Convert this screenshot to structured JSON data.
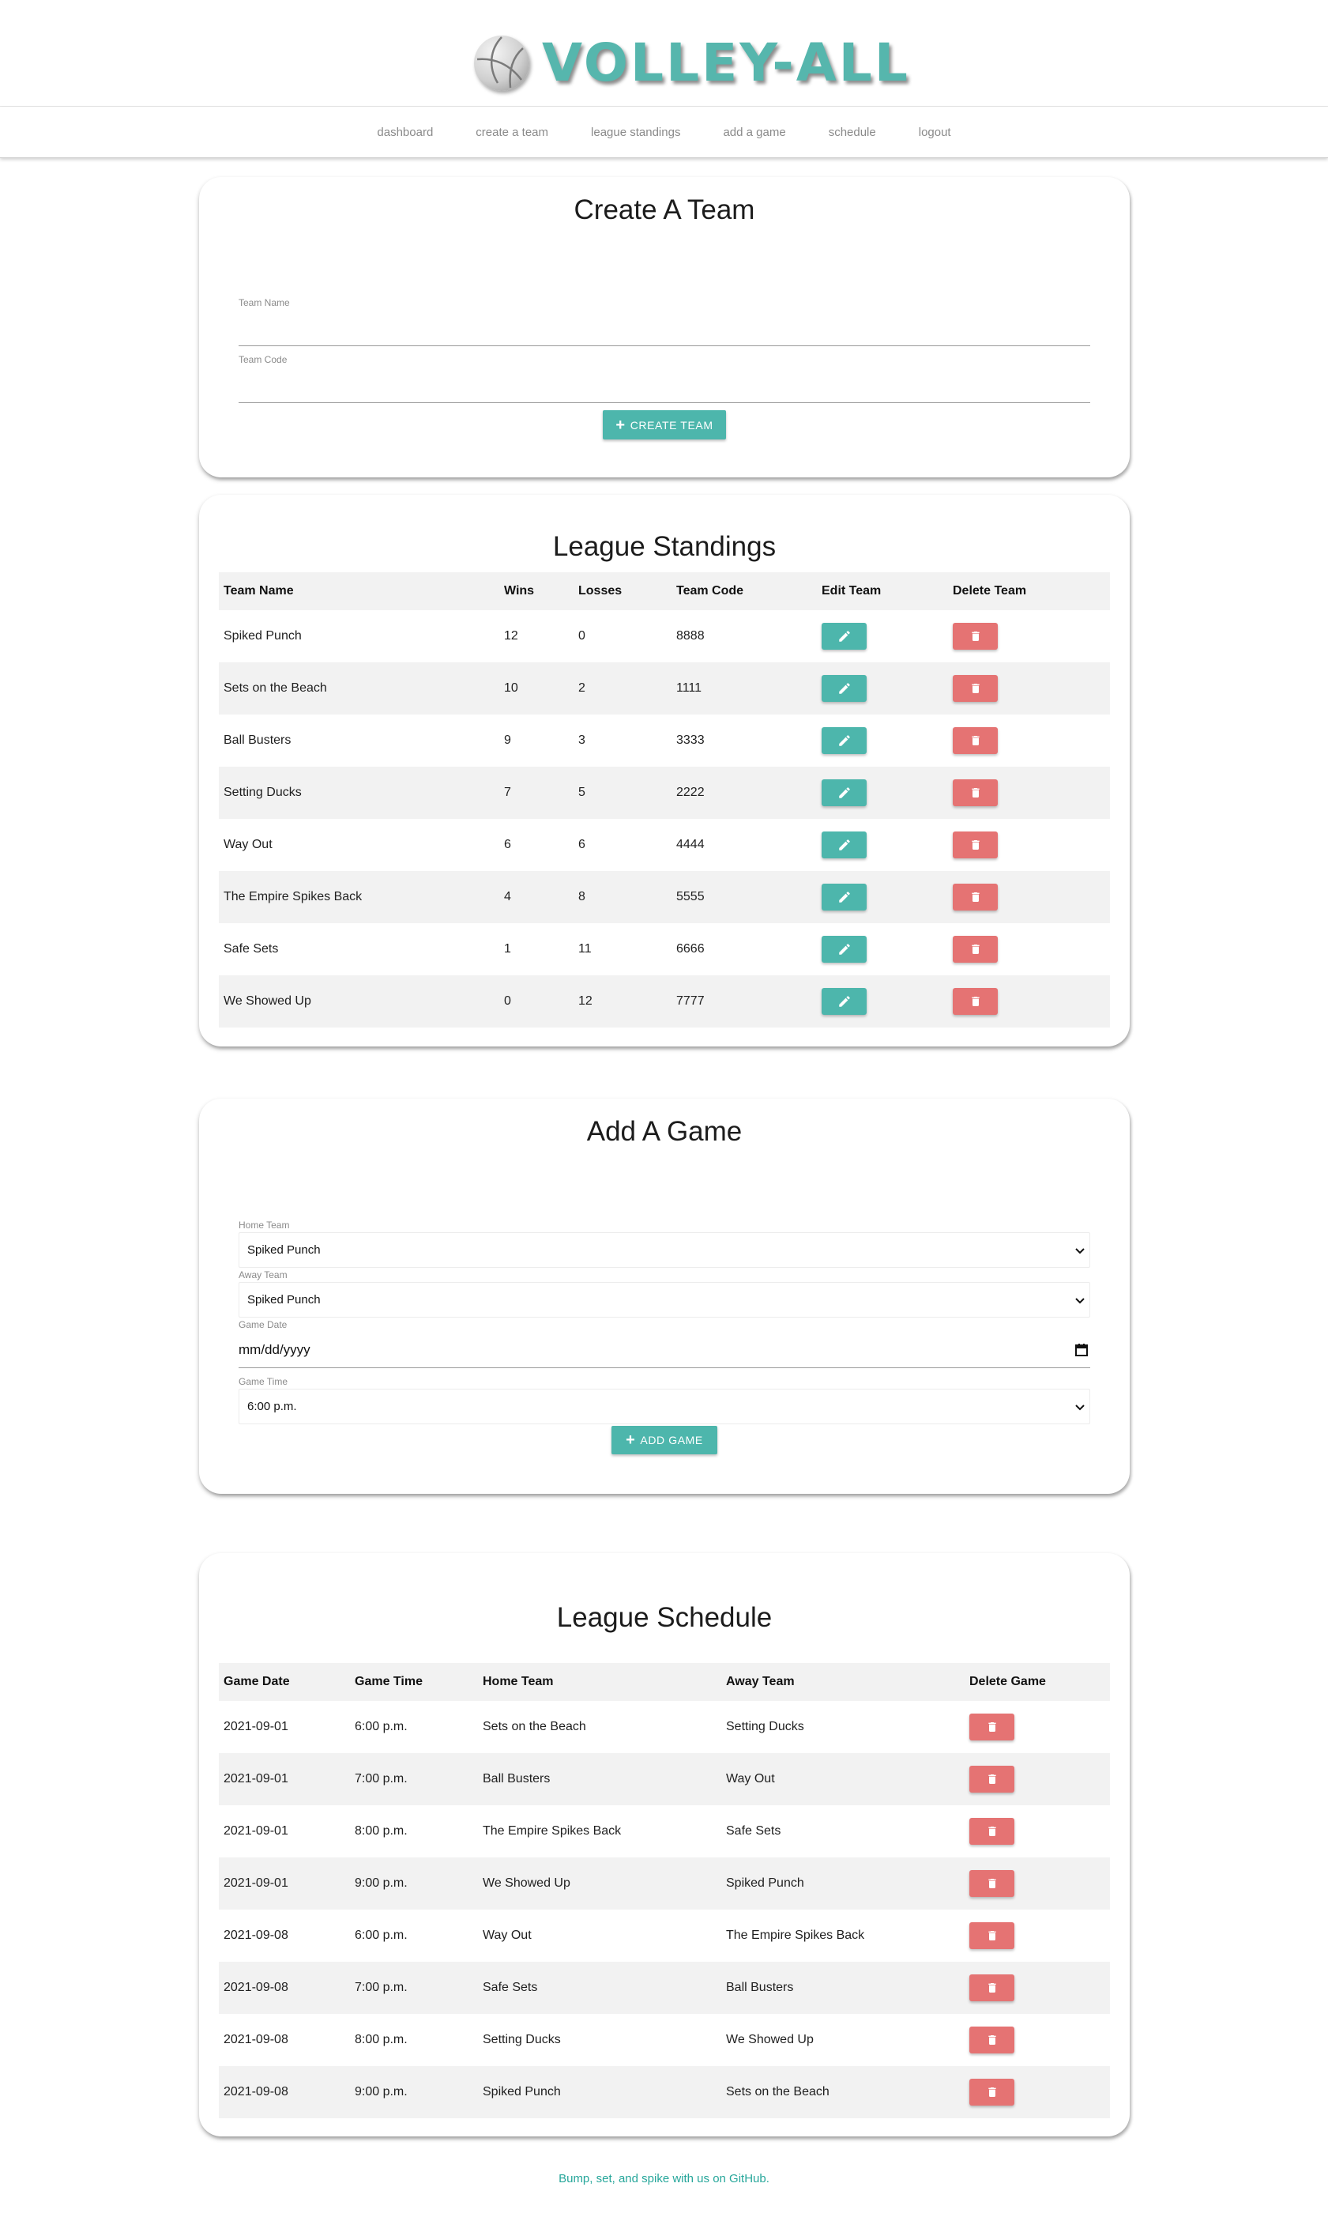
{
  "brand": {
    "title": "VOLLEY-ALL",
    "accent": "#56b6ad"
  },
  "nav": [
    "dashboard",
    "create a team",
    "league standings",
    "add a game",
    "schedule",
    "logout"
  ],
  "create_team": {
    "title": "Create A Team",
    "team_name_label": "Team Name",
    "team_code_label": "Team Code",
    "button_label": "CREATE TEAM"
  },
  "standings": {
    "title": "League Standings",
    "columns": [
      "Team Name",
      "Wins",
      "Losses",
      "Team Code",
      "Edit Team",
      "Delete Team"
    ],
    "rows": [
      [
        "Spiked Punch",
        "12",
        "0",
        "8888"
      ],
      [
        "Sets on the Beach",
        "10",
        "2",
        "1111"
      ],
      [
        "Ball Busters",
        "9",
        "3",
        "3333"
      ],
      [
        "Setting Ducks",
        "7",
        "5",
        "2222"
      ],
      [
        "Way Out",
        "6",
        "6",
        "4444"
      ],
      [
        "The Empire Spikes Back",
        "4",
        "8",
        "5555"
      ],
      [
        "Safe Sets",
        "1",
        "11",
        "6666"
      ],
      [
        "We Showed Up",
        "0",
        "12",
        "7777"
      ]
    ]
  },
  "add_game": {
    "title": "Add A Game",
    "home_label": "Home Team",
    "home_value": "Spiked Punch",
    "away_label": "Away Team",
    "away_value": "Spiked Punch",
    "date_label": "Game Date",
    "date_placeholder": "mm/dd/yyyy",
    "time_label": "Game Time",
    "time_value": "6:00 p.m.",
    "button_label": "ADD GAME"
  },
  "schedule": {
    "title": "League Schedule",
    "columns": [
      "Game Date",
      "Game Time",
      "Home Team",
      "Away Team",
      "Delete Game"
    ],
    "rows": [
      [
        "2021-09-01",
        "6:00 p.m.",
        "Sets on the Beach",
        "Setting Ducks"
      ],
      [
        "2021-09-01",
        "7:00 p.m.",
        "Ball Busters",
        "Way Out"
      ],
      [
        "2021-09-01",
        "8:00 p.m.",
        "The Empire Spikes Back",
        "Safe Sets"
      ],
      [
        "2021-09-01",
        "9:00 p.m.",
        "We Showed Up",
        "Spiked Punch"
      ],
      [
        "2021-09-08",
        "6:00 p.m.",
        "Way Out",
        "The Empire Spikes Back"
      ],
      [
        "2021-09-08",
        "7:00 p.m.",
        "Safe Sets",
        "Ball Busters"
      ],
      [
        "2021-09-08",
        "8:00 p.m.",
        "Setting Ducks",
        "We Showed Up"
      ],
      [
        "2021-09-08",
        "9:00 p.m.",
        "Spiked Punch",
        "Sets on the Beach"
      ]
    ]
  },
  "footer": {
    "text": "Bump, set, and spike with us on GitHub."
  },
  "colors": {
    "teal": "#4db6ac",
    "red": "#e57373",
    "stripe": "#f2f2f2"
  },
  "icons": {
    "edit": "pencil-icon",
    "delete": "trash-icon",
    "add": "plus-icon",
    "select": "chevron-down-icon",
    "date": "calendar-icon"
  }
}
